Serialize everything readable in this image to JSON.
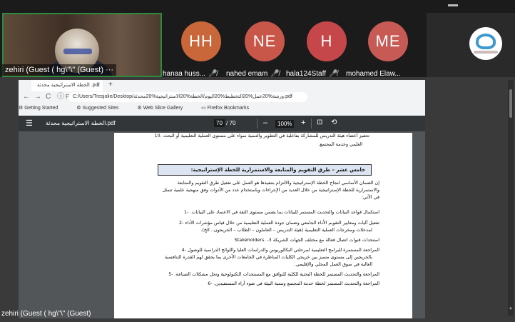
{
  "meeting": {
    "self_tile": {
      "label": "zehiri (Guest ( hg\\\"\\\" (Guest) ···"
    },
    "participants": [
      {
        "initials": "HH",
        "name": "hanaa huss...",
        "color": "#c9663a"
      },
      {
        "initials": "NE",
        "name": "nahed emam",
        "color": "#c8574a"
      },
      {
        "initials": "H",
        "name": "hala124Staff",
        "color": "#c6474a"
      },
      {
        "initials": "ME",
        "name": "mohamed Elaw...",
        "color": "#c75a55"
      }
    ],
    "mic_icon": "mic-off-icon",
    "speaker_label": "zehiri (Guest ( hg\\\"\\\" (Guest)"
  },
  "browser": {
    "tab_title": "الخطة الاستراتيجية محدثة .pdf",
    "tab_close": "×",
    "new_tab": "+",
    "nav": {
      "back": "←",
      "forward": "→",
      "reload": "C",
      "info": "ⓘ",
      "file_label": "File"
    },
    "address": "C:/Users/Tresjolie/Desktop/ورشة%20عمل%20التخطيط%20اليوم/الخطة%20الاستراتيجية%20محدثة.pdf",
    "bookmarks": [
      "Getting Started",
      "Suggested Sites",
      "Web Slice Gallery",
      "Firefox Bookmarks"
    ]
  },
  "pdf_toolbar": {
    "menu_icon": "☰",
    "file_title": "الخطة الاستراتيجية محدثة.pdf",
    "page_current": "70",
    "page_sep": "/",
    "page_total": "70",
    "zoom_minus": "–",
    "zoom": "100%",
    "zoom_plus": "+",
    "fit_icon": "⊡",
    "rotate_icon": "⟲"
  },
  "document": {
    "lines_top": [
      "تحفيز أعضاء هيئة التدريس للمشاركة بفاعلية في التطوير والتنمية سواء على مستوى العملية التعليمية أو البحث .10",
      "العلمي وخدمة المجتمع."
    ],
    "section_heading": "خامس عشر – طرق التقويم والمتابعة والاستمرارية للخطة الإستراتيجية:",
    "intro_lines": [
      "إن الضمان الأساسي لنجاح الخطة الإستراتيجية والالتزام بتنفيذها هو العمل على تفعيل طرق التقويم والمتابعة",
      "والاستمرارية للخطة الإستراتيجية من خلال العديد من الإجراءات وباستخدام عدد من الأدوات وفق منهجية علمية تتمثل",
      "في الآتي:"
    ],
    "items": [
      "استكمال قواعد البيانات والتحديث المستمر للبيانات بما يضمن مستوى الثقة في الاعتماد على البيانات. -1",
      "تفعيل آليات ومعايير التقويم الأداء الجامعي وضمان جودة العملية التعليمية من خلال قياس مؤشرات الأداء -2",
      "لمدخلات ومخرجات العملية التعليمية (هيئة التدريس – العاملون – الطلاب – الخريجون.. الخ).",
      "استحداث قنوات اتصال فعالة مع مختلف الجهات الشريكة Stakeholders. -3",
      "المراجعة المستمرة للبرامج التعليمية لمرحلتي البكالوريوس والدراسات العليا واللوائح الدراسية للوصول -4",
      "بالخريجين إلى مستوى متميز بين خريجي الكليات المناظرة في الجامعات الأخرى بما يحقق لهم القدرة التنافسية",
      "العالية في سوق العمل المحلي والإقليمي.",
      "المراجعة والتحديث المستمر للخطة البحثية للكلية للتوافق مع المستجدات التكنولوجية وتحل مشكلات الصناعة. -5",
      "المراجعة والتحديث المستمر لخطة خدمة المجتمع وتنمية البيئة في ضوء آراء المستفيدين. -6"
    ]
  }
}
